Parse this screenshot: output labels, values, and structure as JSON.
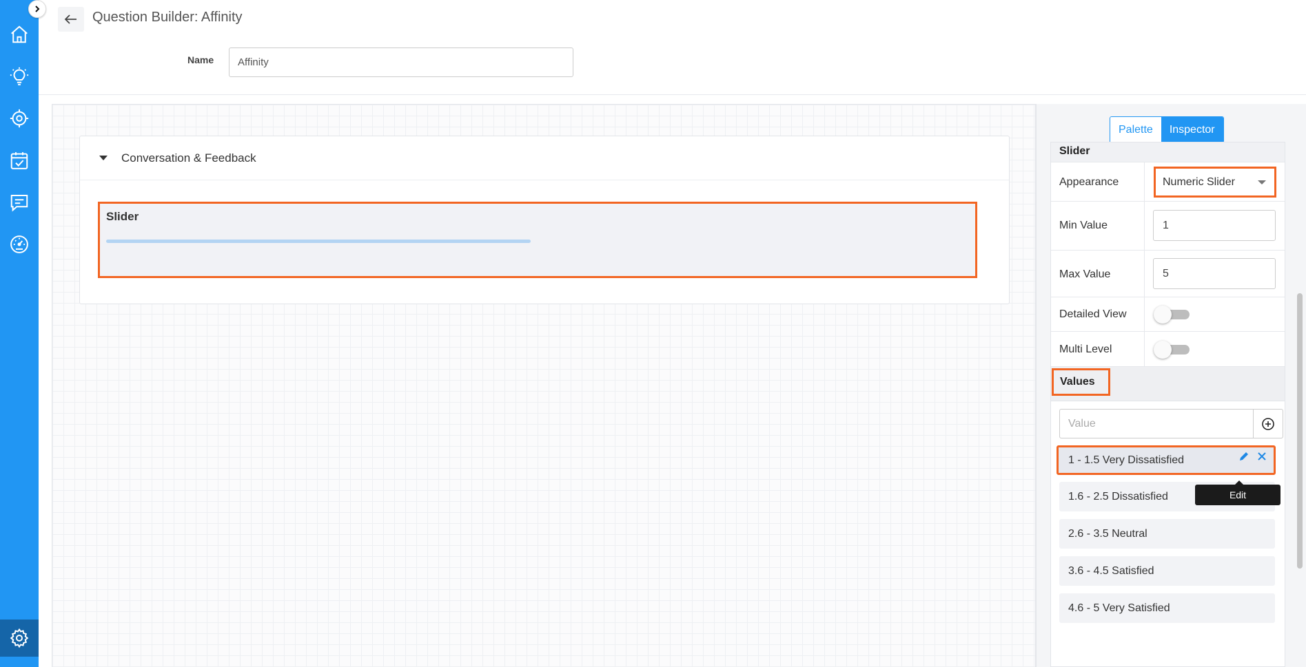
{
  "header": {
    "title": "Question Builder: Affinity",
    "name_label": "Name",
    "name_value": "Affinity"
  },
  "sidebar": {
    "items": [
      {
        "icon": "home-icon"
      },
      {
        "icon": "lightbulb-icon"
      },
      {
        "icon": "target-icon"
      },
      {
        "icon": "calendar-check-icon"
      },
      {
        "icon": "chat-icon"
      },
      {
        "icon": "dashboard-icon"
      },
      {
        "icon": "gear-icon",
        "active": true
      }
    ]
  },
  "canvas": {
    "section_title": "Conversation & Feedback",
    "question_label": "Slider"
  },
  "panel": {
    "tabs": [
      "Palette",
      "Inspector"
    ],
    "active_tab": "Inspector",
    "section_title": "Slider",
    "fields": {
      "appearance_label": "Appearance",
      "appearance_value": "Numeric Slider",
      "min_label": "Min Value",
      "min_value": "1",
      "max_label": "Max Value",
      "max_value": "5",
      "detailed_label": "Detailed View",
      "detailed_on": false,
      "multi_label": "Multi Level",
      "multi_on": false
    },
    "values_title": "Values",
    "value_placeholder": "Value",
    "values": [
      "1 - 1.5 Very Dissatisfied",
      "1.6 - 2.5 Dissatisfied",
      "2.6 - 3.5 Neutral",
      "3.6 - 4.5 Satisfied",
      "4.6 - 5 Very Satisfied"
    ],
    "tooltip": "Edit"
  },
  "colors": {
    "sidebar": "#2196f3",
    "highlight": "#f26522",
    "accent": "#2196f3"
  }
}
